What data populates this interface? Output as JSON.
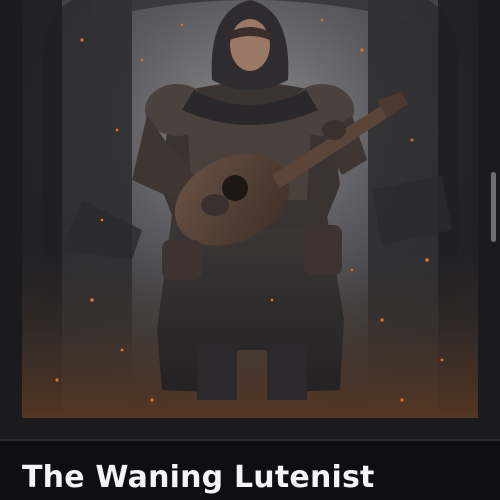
{
  "card": {
    "title": "The Waning Lutenist",
    "image_alt": "Hooded armored bard playing a lute in a misty ruined hall with drifting embers"
  },
  "scrollbar": {
    "position": 0.39
  },
  "colors": {
    "page_background": "#1b1b1e",
    "title_background": "#0f0f11",
    "title_text": "#f4f4f6",
    "ember": "#e0762e"
  }
}
